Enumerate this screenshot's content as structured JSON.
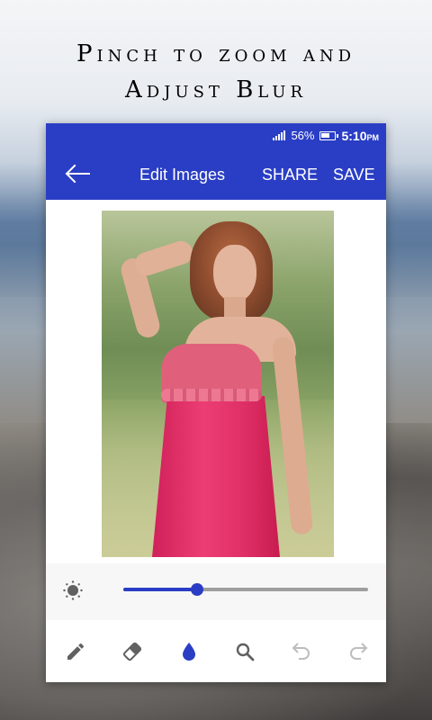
{
  "promo": {
    "line1": "Pinch to zoom and",
    "line2": "Adjust Blur"
  },
  "status_bar": {
    "network": "2",
    "battery": "56%",
    "time": "5:10",
    "ampm": "PM"
  },
  "app_bar": {
    "title": "Edit Images",
    "share_label": "SHARE",
    "save_label": "SAVE",
    "back_icon": "arrow-left-icon"
  },
  "blur_control": {
    "icon": "blur-icon",
    "value_fraction": 0.3
  },
  "toolbar": {
    "tools": [
      {
        "name": "pencil-icon",
        "active": false
      },
      {
        "name": "eraser-icon",
        "active": false
      },
      {
        "name": "drop-icon",
        "active": true
      },
      {
        "name": "zoom-icon",
        "active": false
      },
      {
        "name": "undo-icon",
        "active": false,
        "disabled": true
      },
      {
        "name": "redo-icon",
        "active": false,
        "disabled": true
      }
    ]
  },
  "colors": {
    "primary": "#2a3ec5",
    "icon_gray": "#616161",
    "icon_disabled": "#bdbdbd"
  }
}
